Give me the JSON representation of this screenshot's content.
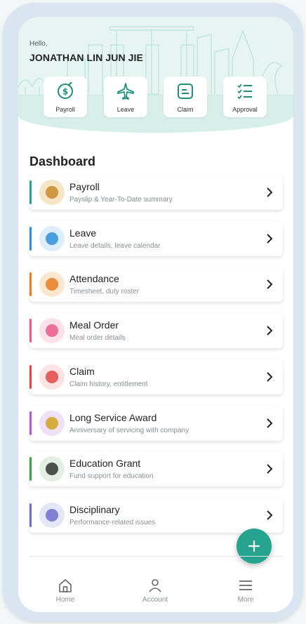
{
  "header": {
    "greeting": "Hello,",
    "user_name": "JONATHAN LIN JUN JIE",
    "quick_actions": [
      {
        "label": "Payroll",
        "icon": "payroll-icon"
      },
      {
        "label": "Leave",
        "icon": "airplane-icon"
      },
      {
        "label": "Claim",
        "icon": "claim-icon"
      },
      {
        "label": "Approval",
        "icon": "checklist-icon"
      }
    ]
  },
  "dashboard": {
    "title": "Dashboard",
    "items": [
      {
        "title": "Payroll",
        "subtitle": "Payslip & Year-To-Date summary",
        "accent": "#26a38f",
        "icon": "money-bag-icon"
      },
      {
        "title": "Leave",
        "subtitle": "Leave details, leave calendar",
        "accent": "#2f8fd8",
        "icon": "paper-plane-icon"
      },
      {
        "title": "Attendance",
        "subtitle": "Timesheet, duty roster",
        "accent": "#e67e22",
        "icon": "clock-icon"
      },
      {
        "title": "Meal Order",
        "subtitle": "Meal order details",
        "accent": "#e85b8a",
        "icon": "plate-icon"
      },
      {
        "title": "Claim",
        "subtitle": "Claim history, entitlement",
        "accent": "#e04848",
        "icon": "receipt-icon"
      },
      {
        "title": "Long Service Award",
        "subtitle": "Anniversary of servicing with company",
        "accent": "#b05bd6",
        "icon": "medal-icon"
      },
      {
        "title": "Education Grant",
        "subtitle": "Fund support for education",
        "accent": "#3aa548",
        "icon": "graduation-cap-icon"
      },
      {
        "title": "Disciplinary",
        "subtitle": "Performance-related issues",
        "accent": "#6f6fd0",
        "icon": "folder-icon"
      }
    ]
  },
  "fab": {
    "icon": "plus-icon"
  },
  "tabbar": {
    "tabs": [
      {
        "label": "Home",
        "icon": "home-icon"
      },
      {
        "label": "Account",
        "icon": "person-icon"
      },
      {
        "label": "More",
        "icon": "menu-icon"
      }
    ]
  },
  "colors": {
    "brand": "#26a38f",
    "header_bg": "#e6f5f1"
  }
}
